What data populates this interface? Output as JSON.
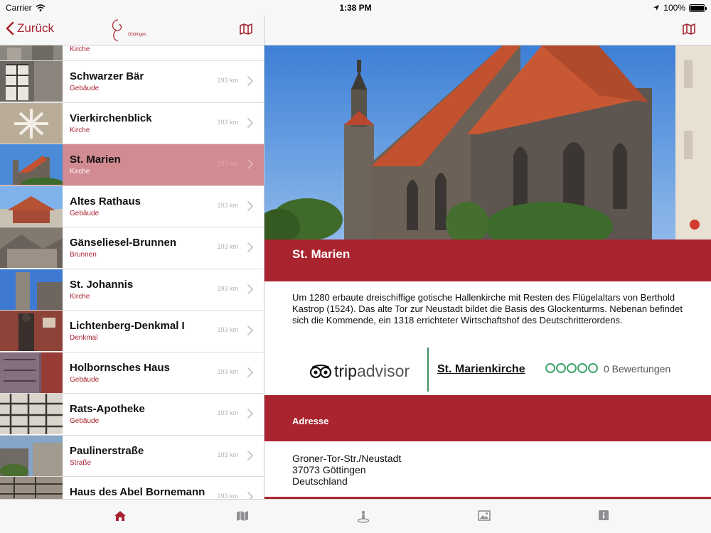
{
  "status_bar": {
    "carrier": "Carrier",
    "time": "1:38 PM",
    "battery": "100%"
  },
  "left_nav": {
    "back_label": "Zurück",
    "logo_text": "Göttingen",
    "logo_tagline": "Stadt, die Wissen schafft"
  },
  "list": {
    "partial_top": {
      "subtitle": "Kirche"
    },
    "items": [
      {
        "title": "Schwarzer Bär",
        "subtitle": "Gebäude",
        "distance": "193 km",
        "selected": false
      },
      {
        "title": "Vierkirchenblick",
        "subtitle": "Kirche",
        "distance": "193 km",
        "selected": false
      },
      {
        "title": "St. Marien",
        "subtitle": "Kirche",
        "distance": "193 km",
        "selected": true
      },
      {
        "title": "Altes Rathaus",
        "subtitle": "Gebäude",
        "distance": "193 km",
        "selected": false
      },
      {
        "title": "Gänseliesel-Brunnen",
        "subtitle": "Brunnen",
        "distance": "193 km",
        "selected": false
      },
      {
        "title": "St. Johannis",
        "subtitle": "Kirche",
        "distance": "193 km",
        "selected": false
      },
      {
        "title": "Lichtenberg-Denkmal I",
        "subtitle": "Denkmal",
        "distance": "193 km",
        "selected": false
      },
      {
        "title": "Holbornsches Haus",
        "subtitle": "Gebäude",
        "distance": "193 km",
        "selected": false
      },
      {
        "title": "Rats-Apotheke",
        "subtitle": "Gebäude",
        "distance": "193 km",
        "selected": false
      },
      {
        "title": "Paulinerstraße",
        "subtitle": "Straße",
        "distance": "193 km",
        "selected": false
      },
      {
        "title": "Haus des Abel Bornemann",
        "subtitle": "",
        "distance": "193 km",
        "selected": false
      }
    ]
  },
  "detail": {
    "title": "St. Marien",
    "description": "Um 1280 erbaute dreischiffige gotische Hallenkirche mit Resten des Flügelaltars von Berthold Kastrop (1524). Das alte Tor zur Neustadt bildet die Basis des Glockenturms. Nebenan befindet sich die Kommende, ein 1318 errichteter Wirtschaftshof des Deutschritterordens.",
    "tripadvisor": {
      "brand_trip": "trip",
      "brand_advisor": "advisor",
      "name": "St. Marienkirche",
      "reviews": "0 Bewertungen",
      "rating": 0
    },
    "address_header": "Adresse",
    "address_lines": [
      "Groner-Tor-Str./Neustadt",
      "37073 Göttingen",
      "Deutschland"
    ]
  },
  "tabs": [
    {
      "icon": "home-icon",
      "active": true
    },
    {
      "icon": "map-icon",
      "active": false
    },
    {
      "icon": "person-location-icon",
      "active": false
    },
    {
      "icon": "image-icon",
      "active": false
    },
    {
      "icon": "info-icon",
      "active": false
    }
  ],
  "colors": {
    "accent": "#aa2430",
    "selected_row": "#d28b91",
    "ta_green": "#3da569"
  }
}
